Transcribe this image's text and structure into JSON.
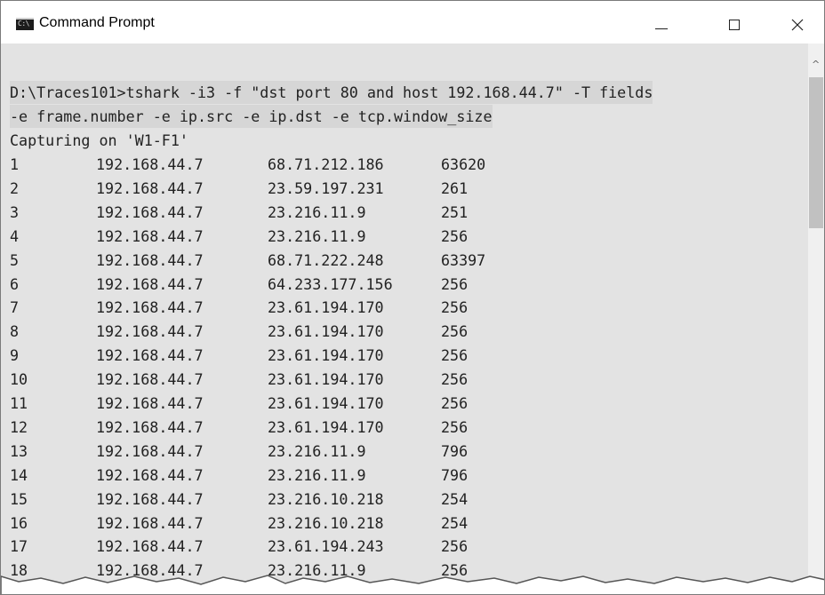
{
  "window": {
    "title": "Command Prompt",
    "icon_label": "C:\\",
    "icon_name": "command-prompt-icon",
    "controls": {
      "minimize_icon": "minimize-icon",
      "maximize_icon": "maximize-icon",
      "close_icon": "close-icon"
    }
  },
  "console": {
    "command_lines": [
      "D:\\Traces101>tshark -i3 -f \"dst port 80 and host 192.168.44.7\" -T fields",
      "-e frame.number -e ip.src -e ip.dst -e tcp.window_size"
    ],
    "status_line": "Capturing on 'W1-F1'",
    "rows": [
      {
        "num": "1",
        "src": "192.168.44.7",
        "dst": "68.71.212.186",
        "win": "63620"
      },
      {
        "num": "2",
        "src": "192.168.44.7",
        "dst": "23.59.197.231",
        "win": "261"
      },
      {
        "num": "3",
        "src": "192.168.44.7",
        "dst": "23.216.11.9",
        "win": "251"
      },
      {
        "num": "4",
        "src": "192.168.44.7",
        "dst": "23.216.11.9",
        "win": "256"
      },
      {
        "num": "5",
        "src": "192.168.44.7",
        "dst": "68.71.222.248",
        "win": "63397"
      },
      {
        "num": "6",
        "src": "192.168.44.7",
        "dst": "64.233.177.156",
        "win": "256"
      },
      {
        "num": "7",
        "src": "192.168.44.7",
        "dst": "23.61.194.170",
        "win": "256"
      },
      {
        "num": "8",
        "src": "192.168.44.7",
        "dst": "23.61.194.170",
        "win": "256"
      },
      {
        "num": "9",
        "src": "192.168.44.7",
        "dst": "23.61.194.170",
        "win": "256"
      },
      {
        "num": "10",
        "src": "192.168.44.7",
        "dst": "23.61.194.170",
        "win": "256"
      },
      {
        "num": "11",
        "src": "192.168.44.7",
        "dst": "23.61.194.170",
        "win": "256"
      },
      {
        "num": "12",
        "src": "192.168.44.7",
        "dst": "23.61.194.170",
        "win": "256"
      },
      {
        "num": "13",
        "src": "192.168.44.7",
        "dst": "23.216.11.9",
        "win": "796"
      },
      {
        "num": "14",
        "src": "192.168.44.7",
        "dst": "23.216.11.9",
        "win": "796"
      },
      {
        "num": "15",
        "src": "192.168.44.7",
        "dst": "23.216.10.218",
        "win": "254"
      },
      {
        "num": "16",
        "src": "192.168.44.7",
        "dst": "23.216.10.218",
        "win": "254"
      },
      {
        "num": "17",
        "src": "192.168.44.7",
        "dst": "23.61.194.243",
        "win": "256"
      },
      {
        "num": "18",
        "src": "192.168.44.7",
        "dst": "23.216.11.9",
        "win": "256"
      }
    ]
  },
  "scrollbar": {
    "up_arrow_icon": "scroll-up-arrow-icon"
  },
  "colors": {
    "console_background": "#e3e3e3",
    "console_text": "#222222",
    "command_highlight": "#d6d6d6",
    "titlebar_background": "#ffffff"
  }
}
